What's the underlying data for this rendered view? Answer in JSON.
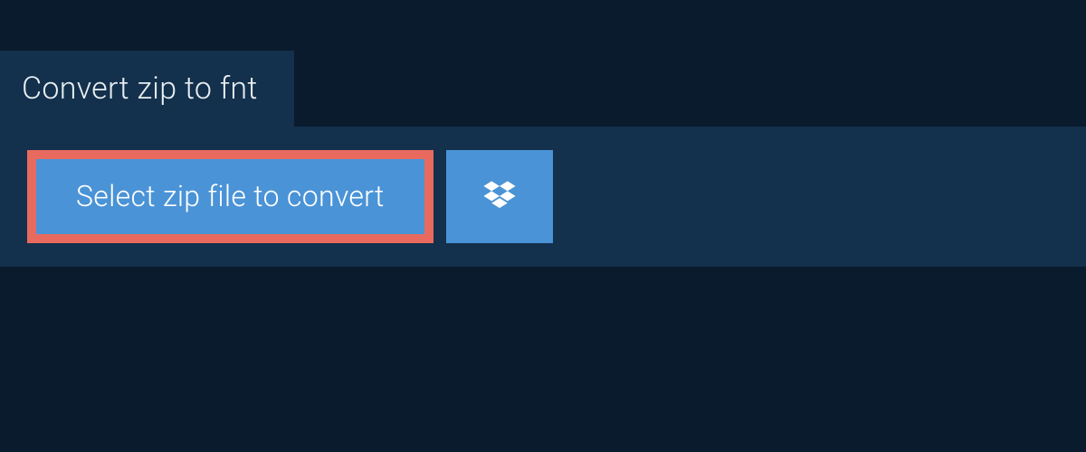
{
  "tab": {
    "title": "Convert zip to fnt"
  },
  "actions": {
    "select_label": "Select zip file to convert"
  },
  "colors": {
    "page_bg": "#0a1b2e",
    "panel_bg": "#13304c",
    "button_bg": "#4a93d6",
    "highlight_border": "#e86a5f",
    "text": "#ffffff"
  }
}
